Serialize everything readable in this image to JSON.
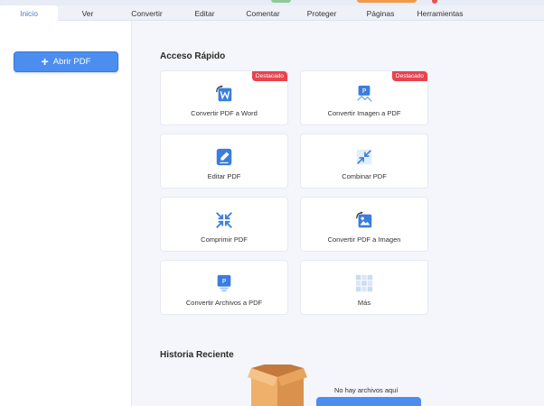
{
  "ribbon": {
    "tabs": [
      {
        "label": "Inicio"
      },
      {
        "label": "Ver"
      },
      {
        "label": "Convertir"
      },
      {
        "label": "Editar"
      },
      {
        "label": "Comentar"
      },
      {
        "label": "Proteger"
      },
      {
        "label": "Páginas"
      },
      {
        "label": "Herramientas"
      }
    ],
    "active_tab": "Inicio"
  },
  "sidebar": {
    "open_button": "Abrir PDF"
  },
  "quick_access": {
    "title": "Acceso Rápido",
    "badge_label": "Destacado",
    "cards": [
      {
        "label": "Convertir PDF a Word",
        "icon": "pdf-to-word-icon",
        "featured": true
      },
      {
        "label": "Convertir Imagen a PDF",
        "icon": "image-to-pdf-icon",
        "featured": true
      },
      {
        "label": "Editar PDF",
        "icon": "edit-pdf-icon",
        "featured": false
      },
      {
        "label": "Combinar PDF",
        "icon": "combine-pdf-icon",
        "featured": false
      },
      {
        "label": "Comprimir PDF",
        "icon": "compress-pdf-icon",
        "featured": false
      },
      {
        "label": "Convertir PDF a Imagen",
        "icon": "pdf-to-image-icon",
        "featured": false
      },
      {
        "label": "Convertir Archivos a PDF",
        "icon": "files-to-pdf-icon",
        "featured": false
      },
      {
        "label": "Más",
        "icon": "more-grid-icon",
        "featured": false
      }
    ]
  },
  "recent": {
    "title": "Historia Reciente",
    "empty_text": "No hay archivos aquí",
    "empty_icon": "open-box-icon"
  },
  "colors": {
    "accent": "#4c8ef0",
    "badge": "#e8434e",
    "active_tab_text": "#4a7bd0",
    "box": "#e8a35c"
  }
}
